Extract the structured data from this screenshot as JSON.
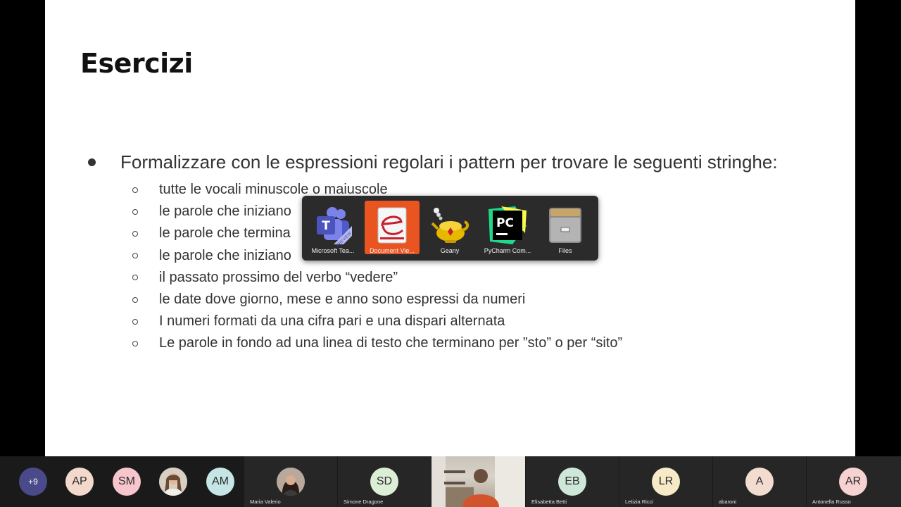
{
  "slide": {
    "title": "Esercizi",
    "main_bullet": "Formalizzare con le espressioni regolari i pattern per trovare le seguenti stringhe:",
    "sub_items": [
      "tutte le vocali minuscole o maiuscole",
      "le parole che iniziano",
      "le parole che termina",
      "le parole che iniziano",
      "il passato prossimo del verbo “vedere”",
      "le date dove giorno, mese e anno sono espressi da numeri",
      "I numeri formati da una cifra pari e una dispari alternata",
      "Le parole in fondo ad una linea di testo che terminano per ”sto” o per “sito”"
    ]
  },
  "app_switcher": {
    "apps": [
      {
        "label": "Microsoft Tea...",
        "icon": "teams-icon",
        "selected": false
      },
      {
        "label": "Document Vie...",
        "icon": "document-viewer-icon",
        "selected": true
      },
      {
        "label": "Geany",
        "icon": "geany-icon",
        "selected": false
      },
      {
        "label": "PyCharm Com...",
        "icon": "pycharm-icon",
        "selected": false
      },
      {
        "label": "Files",
        "icon": "files-icon",
        "selected": false
      }
    ],
    "accent": "#e95420"
  },
  "participants": {
    "overflow": "+9",
    "avatars": [
      {
        "initials": "AP",
        "color": "#f3d9cc"
      },
      {
        "initials": "SM",
        "color": "#f6c6cc"
      },
      {
        "initials": "AM",
        "color": "#c6e6e6"
      }
    ],
    "tiles": [
      {
        "name": "Maria Valerio",
        "initials": ""
      },
      {
        "name": "Simone Dragone",
        "initials": "SD",
        "color": "#dcefd6"
      },
      {
        "name": "Elisabetta Betti",
        "initials": "EB",
        "color": "#cfe7d9"
      },
      {
        "name": "Letizia Ricci",
        "initials": "LR",
        "color": "#f7eac6"
      },
      {
        "name": "abaroni",
        "initials": "A",
        "color": "#f1dccf"
      },
      {
        "name": "Antonella Russo",
        "initials": "AR",
        "color": "#f7d2d2"
      }
    ]
  }
}
